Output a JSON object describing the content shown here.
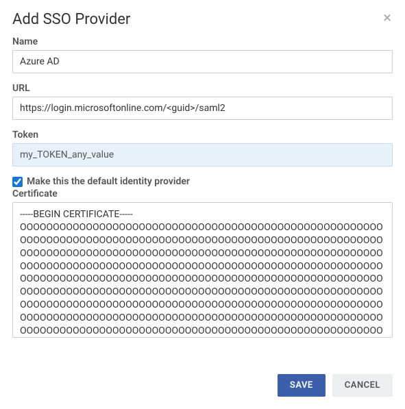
{
  "dialog": {
    "title": "Add SSO Provider",
    "close_glyph": "×"
  },
  "fields": {
    "name": {
      "label": "Name",
      "value": "Azure AD"
    },
    "url": {
      "label": "URL",
      "value": "https://login.microsoftonline.com/<guid>/saml2"
    },
    "token": {
      "label": "Token",
      "value": "my_TOKEN_any_value"
    },
    "default_provider": {
      "label": "Make this the default identity provider",
      "checked": true
    },
    "certificate": {
      "label": "Certificate",
      "value": "-----BEGIN CERTIFICATE-----\nOOOOOOOOOOOOOOOOOOOOOOOOOOOOOOOOOOOOOOOOOOOOOOOOOOOOOOOOOOOOOOOOOOOOOOOOOOOOOOOOOOOOOOOOOOOOOOOOOOOOOOOOOOOOOOOOOOOOOOOOOOOOOOOOOOOOOOOOOOOOOOOOOOOOOOOOOOOOOOOOOOOOOOOOOOOOOOOOOOOOOOOOOOOOOOOOOOOOOOOOOOOOOOOOOOOOOOOOOOOOOOOOOOOOOOOOOOOOOOOOOOOOOOOOOOOOOOOOOOOOOOOOOOOOOOOOOOOOOOOOOOOOOOOOOOOOOOOOOOOOOOOOOOOOOOOOOOOOOOOOOOOOOOOOOOOOOOOOOOOOOOOOOOOOOOOOOOOOOOOOOOOOOOOOOOOOOOOOOOOOOOOOOOOOOOOOOOOOOOOOOOOOOOOOOOOOOOOOOOOOOOOOOOOOOOOOOOOOOOOOOOOOOOOOOOOOOOOOOOOOOOOOOOOOOOOOOOOOOOOOOOOOOOOOOOOOOOOOOOOOOOOOOOOOOOOOOOOOOOOOOOOOOOOOOOOOOOOOOOOOOOOOOOOOOOOOOOOOOOOOOOOOOOOOOOOOOOOOOOOOOOOOOOOOOOOOOOOOOOOOOOOOOOOOOOOOOOOOOOOOOOOOOOOOOOOOOOOOOOOO"
    }
  },
  "footer": {
    "save_label": "SAVE",
    "cancel_label": "CANCEL"
  }
}
